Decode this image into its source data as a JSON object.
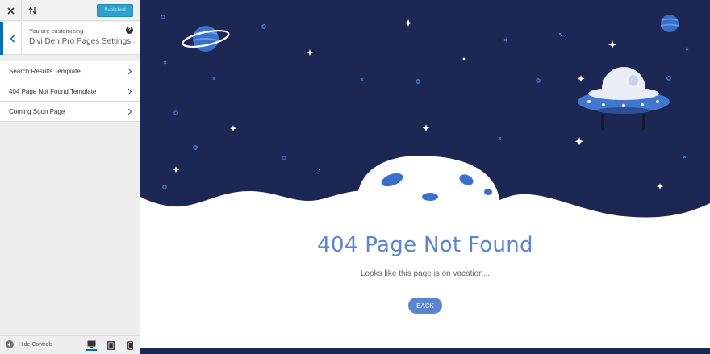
{
  "app": {
    "publish_label": "Published",
    "customizing_label": "You are customizing",
    "panel_title": "Divi Den Pro Pages Settings",
    "help_glyph": "?"
  },
  "sections": [
    {
      "label": "Search Results Template"
    },
    {
      "label": "404 Page Not Found Template"
    },
    {
      "label": "Coming Soon Page"
    }
  ],
  "footer": {
    "hide_controls_label": "Hide Controls"
  },
  "page": {
    "heading": "404 Page Not Found",
    "subtext": "Looks like this page is on vacation...",
    "back_label": "BACK"
  },
  "colors": {
    "space_bg": "#1c2754",
    "accent": "#5b85ce",
    "planet": "#3a70c9",
    "ufo_body": "#4177cf",
    "wp_blue": "#0073aa"
  },
  "icons": [
    "close-icon",
    "sort-arrows-icon",
    "chevron-left-icon",
    "help-icon",
    "chevron-right-icon",
    "arrow-left-circle-icon",
    "desktop-icon",
    "tablet-icon",
    "mobile-icon",
    "ringed-planet-icon",
    "planet-icon",
    "ufo-icon",
    "moon-icon"
  ]
}
